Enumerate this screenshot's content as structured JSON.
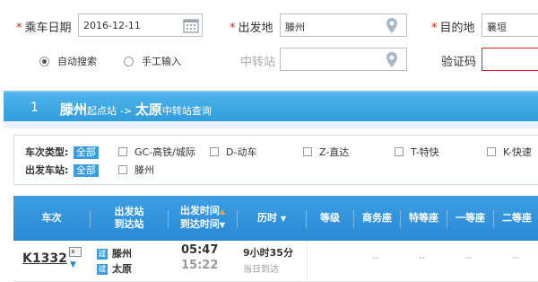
{
  "form": {
    "date_label": "乘车日期",
    "date_value": "2016-12-11",
    "from_label": "出发地",
    "from_value": "滕州",
    "to_label": "目的地",
    "to_value": "襄垣",
    "transfer_placeholder": "中转站",
    "captcha_label": "验证码",
    "radio_auto": "自动搜索",
    "radio_manual": "手工输入",
    "required_mark": "*"
  },
  "title_bar": {
    "index": "1",
    "origin": "滕州",
    "origin_suffix": "起点站",
    "arrow": "->",
    "destination": "太原",
    "destination_suffix": "中转站查询"
  },
  "filter": {
    "type_label": "车次类型:",
    "station_label": "出发车站:",
    "all_label": "全部",
    "types": [
      "GC-高铁/城际",
      "D-动车",
      "Z-直达",
      "T-特快",
      "K-快速"
    ],
    "stations": [
      "滕州"
    ]
  },
  "table": {
    "headers": {
      "train": "车次",
      "station_top": "出发站",
      "station_bottom": "到达站",
      "time_top": "出发时间",
      "time_bottom": "到达时间",
      "duration": "历时",
      "grade": "等级",
      "business": "商务座",
      "premium": "特等座",
      "first": "一等座",
      "second": "二等座"
    },
    "sort_up": "▲",
    "sort_down": "▼",
    "row": {
      "train_no": "K1332",
      "from_badge": "过",
      "to_badge": "过",
      "from_station": "滕州",
      "to_station": "太原",
      "depart": "05:47",
      "arrive": "15:22",
      "duration": "9小时35分",
      "arrival_note": "当日到达",
      "dash": "--"
    }
  },
  "icons": {
    "calendar": "calendar-icon",
    "location": "location-pin-icon",
    "card": "id-card-icon",
    "chevron": "chevron-down-icon"
  },
  "colors": {
    "accent": "#319ddb",
    "header": "#2a89d3",
    "required": "#d21111",
    "captcha_border": "#e02020"
  }
}
